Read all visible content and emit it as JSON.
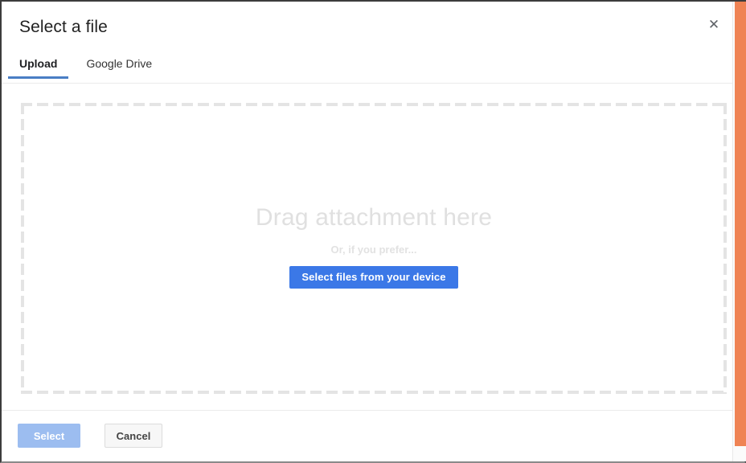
{
  "dialog": {
    "title": "Select a file",
    "close_icon": "close-icon",
    "close_glyph": "✕"
  },
  "tabs": [
    {
      "label": "Upload",
      "active": true
    },
    {
      "label": "Google Drive",
      "active": false
    }
  ],
  "dropzone": {
    "headline": "Drag attachment here",
    "subtext": "Or, if you prefer...",
    "select_files_label": "Select files from your device"
  },
  "footer": {
    "select_label": "Select",
    "cancel_label": "Cancel"
  },
  "colors": {
    "accent_blue": "#3b78e7",
    "tab_underline": "#4a7ec4",
    "disabled_blue": "#9cbdf0",
    "scrollbar_thumb": "#ef8354",
    "dashed_border": "#e4e4e4",
    "placeholder_text": "#e0e0e0"
  }
}
